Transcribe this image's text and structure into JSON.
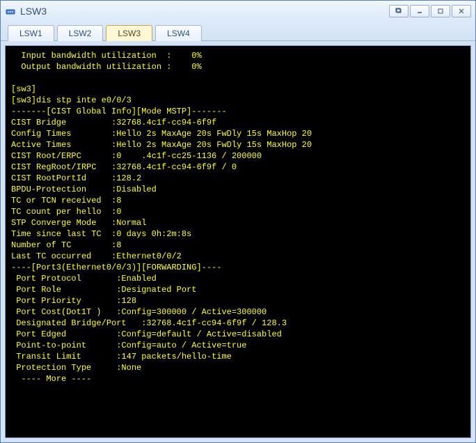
{
  "window": {
    "title": "LSW3"
  },
  "tabs": [
    {
      "label": "LSW1",
      "active": false
    },
    {
      "label": "LSW2",
      "active": false
    },
    {
      "label": "LSW3",
      "active": true
    },
    {
      "label": "LSW4",
      "active": false
    }
  ],
  "terminal": {
    "lines": [
      "  Input bandwidth utilization  :    0%",
      "  Output bandwidth utilization :    0%",
      "",
      "[sw3]",
      "[sw3]dis stp inte e0/0/3",
      "-------[CIST Global Info][Mode MSTP]-------",
      "CIST Bridge         :32768.4c1f-cc94-6f9f",
      "Config Times        :Hello 2s MaxAge 20s FwDly 15s MaxHop 20",
      "Active Times        :Hello 2s MaxAge 20s FwDly 15s MaxHop 20",
      "CIST Root/ERPC      :0    .4c1f-cc25-1136 / 200000",
      "CIST RegRoot/IRPC   :32768.4c1f-cc94-6f9f / 0",
      "CIST RootPortId     :128.2",
      "BPDU-Protection     :Disabled",
      "TC or TCN received  :8",
      "TC count per hello  :0",
      "STP Converge Mode   :Normal",
      "Time since last TC  :0 days 0h:2m:8s",
      "Number of TC        :8",
      "Last TC occurred    :Ethernet0/0/2",
      "----[Port3(Ethernet0/0/3)][FORWARDING]----",
      " Port Protocol       :Enabled",
      " Port Role           :Designated Port",
      " Port Priority       :128",
      " Port Cost(Dot1T )   :Config=300000 / Active=300000",
      " Designated Bridge/Port   :32768.4c1f-cc94-6f9f / 128.3",
      " Port Edged          :Config=default / Active=disabled",
      " Point-to-point      :Config=auto / Active=true",
      " Transit Limit       :147 packets/hello-time",
      " Protection Type     :None",
      "  ---- More ----"
    ]
  }
}
